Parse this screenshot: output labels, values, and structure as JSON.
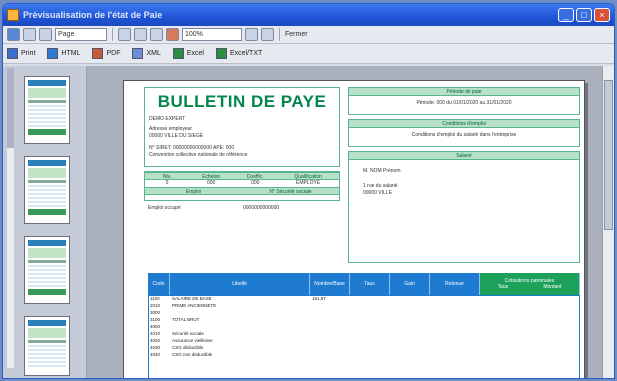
{
  "window": {
    "title": "Prévisualisation de l'état de Paie"
  },
  "toolbar": {
    "page_combo": "Page",
    "zoom_combo": "100%",
    "close_label": "Fermer"
  },
  "exports": [
    {
      "label": "Print",
      "color": "#3a6fd0"
    },
    {
      "label": "HTML",
      "color": "#2d7ad3"
    },
    {
      "label": "PDF",
      "color": "#c85a3c"
    },
    {
      "label": "XML",
      "color": "#6a8bd6"
    },
    {
      "label": "Excel",
      "color": "#2e8b42"
    },
    {
      "label": "Excel/TXT",
      "color": "#2e8b42"
    }
  ],
  "bulletin": {
    "title": "BULLETIN DE PAYE",
    "company_name": "DEMO EXPERT",
    "company_address": [
      "Adresse employeur",
      "00000    VILLE DU SIEGE"
    ],
    "company_ids": "N° SIRET: 00000000000000      APE: 000",
    "convention": "Convention collective nationale de référence",
    "id_headers": [
      "Niv.",
      "Echelon",
      "Coeffic.",
      "Qualification"
    ],
    "id_values": [
      "0",
      "000",
      "000",
      "EMPLOYE"
    ],
    "emploi_headers": [
      "Emploi",
      "N° Sécurité sociale"
    ],
    "emploi_values": [
      "Emploi occupé",
      "0000000000000"
    ],
    "periode_header": "Période de paie",
    "periode_value": "Période: 000 du 01/01/2020 au 31/01/2020",
    "conditions_header": "Conditions d'emploi",
    "conditions_value": "Conditions d'emploi du salarié dans l'entreprise",
    "salarie_header": "Salarié",
    "salarie_lines": [
      "M. NOM Prénom",
      "",
      "1 rue du salarié",
      "00000    VILLE"
    ]
  },
  "table": {
    "headers": [
      "Code",
      "Libellé",
      "Nombre/Base",
      "Taux",
      "Gain",
      "Retenue",
      "Cotisations patronales"
    ],
    "sub_headers": [
      "Taux",
      "Montant"
    ],
    "rows": [
      [
        "1100",
        "SALAIRE DE BASE",
        "151,67",
        "",
        "",
        "",
        ""
      ],
      [
        "2010",
        "PRIME ANCIENNETE",
        "",
        "",
        "",
        "",
        ""
      ],
      [
        "3000",
        "",
        "",
        "",
        "",
        "",
        ""
      ],
      [
        "3100",
        "TOTAL BRUT",
        "",
        "",
        "",
        "",
        ""
      ],
      [
        "4000",
        "",
        "",
        "",
        "",
        "",
        ""
      ],
      [
        "4010",
        "Sécurité sociale",
        "",
        "",
        "",
        "",
        ""
      ],
      [
        "4020",
        "Assurance vieillesse",
        "",
        "",
        "",
        "",
        ""
      ],
      [
        "4030",
        "CSG déductible",
        "",
        "",
        "",
        "",
        ""
      ],
      [
        "4040",
        "CSG non déductible",
        "",
        "",
        "",
        "",
        ""
      ]
    ]
  }
}
